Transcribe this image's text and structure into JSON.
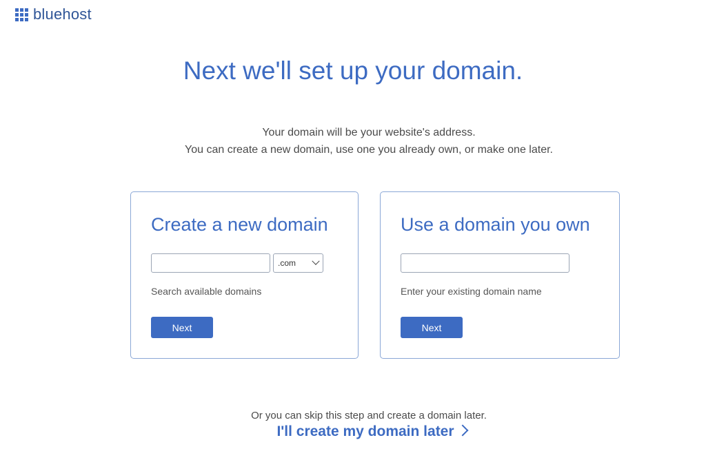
{
  "brand": {
    "name": "bluehost",
    "color": "#3d6bc2"
  },
  "heading": "Next we'll set up your domain.",
  "subtext": {
    "line1": "Your domain will be your website's address.",
    "line2": "You can create a new domain, use one you already own, or make one later."
  },
  "create_card": {
    "title": "Create a new domain",
    "input_value": "",
    "tld_selected": ".com",
    "helper": "Search available domains",
    "button_label": "Next"
  },
  "own_card": {
    "title": "Use a domain you own",
    "input_value": "",
    "helper": "Enter your existing domain name",
    "button_label": "Next"
  },
  "skip": {
    "text": "Or you can skip this step and create a domain later.",
    "link_label": "I'll create my domain later"
  },
  "icons": [
    "bluehost-logo-icon",
    "chevron-down-icon",
    "chevron-right-icon"
  ]
}
